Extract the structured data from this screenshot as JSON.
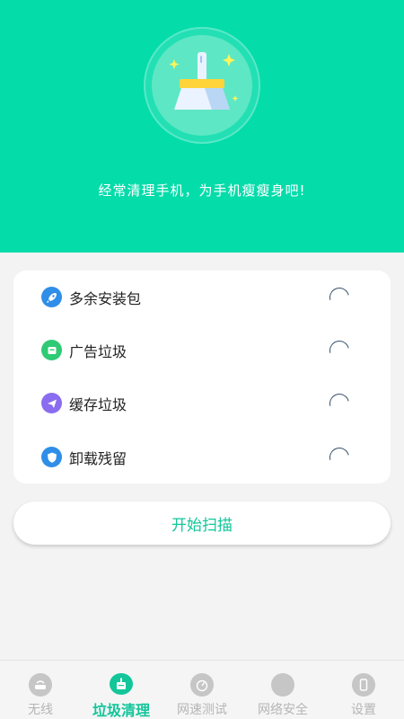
{
  "header": {
    "slogan": "经常清理手机，为手机瘦瘦身吧!"
  },
  "scan_items": [
    {
      "label": "多余安装包",
      "icon": "rocket-icon",
      "color": "#2f8ee8"
    },
    {
      "label": "广告垃圾",
      "icon": "ad-icon",
      "color": "#2fca74"
    },
    {
      "label": "缓存垃圾",
      "icon": "send-icon",
      "color": "#8a6cf0"
    },
    {
      "label": "卸载残留",
      "icon": "shield-icon",
      "color": "#2f8ee8"
    }
  ],
  "scan_button": {
    "label": "开始扫描"
  },
  "tabs": [
    {
      "label": "无线",
      "icon": "wifi-router-icon",
      "active": false
    },
    {
      "label": "垃圾清理",
      "icon": "broom-icon",
      "active": true
    },
    {
      "label": "网速测试",
      "icon": "speedometer-icon",
      "active": false
    },
    {
      "label": "网络安全",
      "icon": "network-security-icon",
      "active": false
    },
    {
      "label": "设置",
      "icon": "phone-settings-icon",
      "active": false
    }
  ],
  "colors": {
    "primary": "#04dcaa",
    "accent_text": "#12c69a"
  }
}
